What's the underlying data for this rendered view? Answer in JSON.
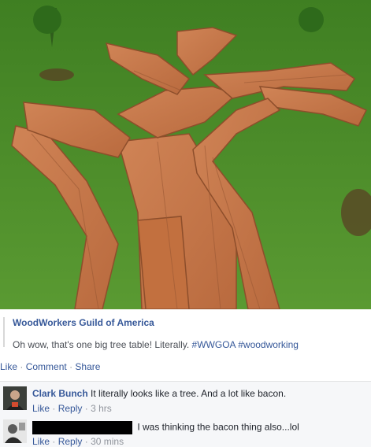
{
  "post": {
    "page_name": "WoodWorkers Guild of America",
    "text": "Oh wow, that's one big tree table! Literally.",
    "hashtags": [
      "#WWGOA",
      "#woodworking"
    ]
  },
  "actions": {
    "like": "Like",
    "comment": "Comment",
    "share": "Share",
    "sep": "·"
  },
  "comments": [
    {
      "author": "Clark Bunch",
      "text": "It literally looks like a tree. And a lot like bacon.",
      "like": "Like",
      "reply": "Reply",
      "time": "3 hrs"
    },
    {
      "author": "",
      "text": "I was thinking the bacon thing also...lol",
      "like": "Like",
      "reply": "Reply",
      "time": "30 mins"
    }
  ],
  "colors": {
    "link": "#365899",
    "meta": "#90949c",
    "grass": "#4f8f2a",
    "wood": "#c8754a"
  },
  "icons": {
    "avatar_1": "person-avatar",
    "avatar_2": "person-avatar"
  }
}
